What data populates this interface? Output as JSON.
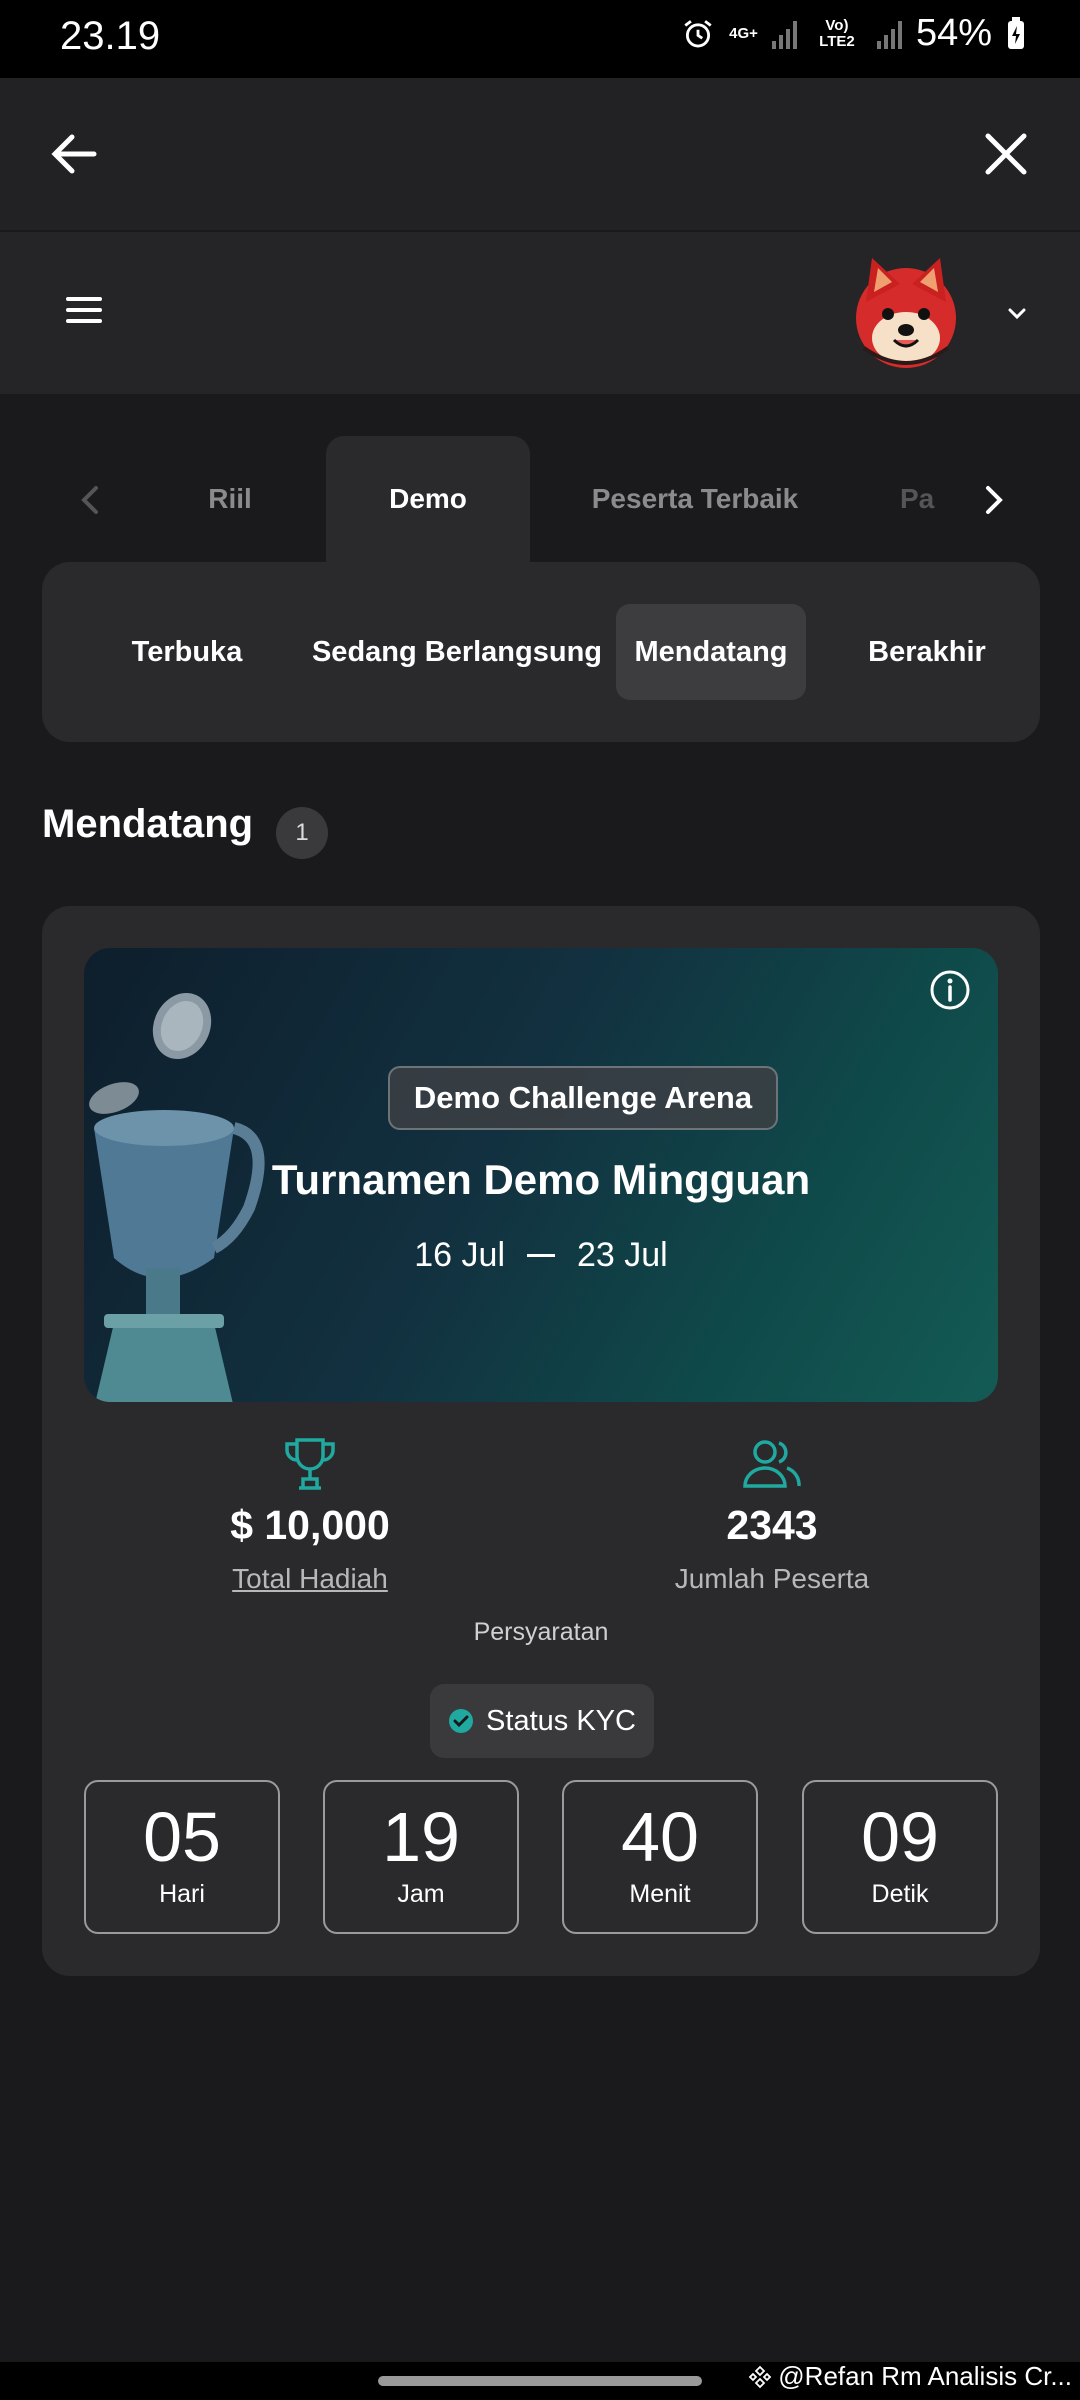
{
  "status_bar": {
    "time": "23.19",
    "network_top": "4G+",
    "network_bottom": "Vo) LTE2",
    "battery": "54%"
  },
  "tabs": {
    "items": [
      "Riil",
      "Demo",
      "Peserta Terbaik",
      "Pa"
    ],
    "active": "Demo"
  },
  "filters": {
    "items": [
      "Terbuka",
      "Sedang Berlangsung",
      "Mendatang",
      "Berakhir"
    ],
    "active": "Mendatang"
  },
  "section": {
    "title": "Mendatang",
    "count": "1"
  },
  "card": {
    "badge": "Demo Challenge Arena",
    "title": "Turnamen Demo Mingguan",
    "date_start": "16 Jul",
    "date_end": "23 Jul",
    "prize_value": "$ 10,000",
    "prize_label": "Total Hadiah",
    "participants_value": "2343",
    "participants_label": "Jumlah Peserta",
    "requirements_label": "Persyaratan",
    "kyc_label": "Status KYC",
    "countdown": [
      {
        "value": "05",
        "unit": "Hari"
      },
      {
        "value": "19",
        "unit": "Jam"
      },
      {
        "value": "40",
        "unit": "Menit"
      },
      {
        "value": "09",
        "unit": "Detik"
      }
    ]
  },
  "watermark": "@Refan Rm Analisis Cr...",
  "colors": {
    "accent_teal": "#1fa9a0",
    "background": "#1a1a1c",
    "surface": "#2a2a2c"
  },
  "icons": [
    "back-arrow-icon",
    "close-icon",
    "menu-icon",
    "shiba-avatar-icon",
    "chevron-down-icon",
    "chevron-left-icon",
    "chevron-right-icon",
    "info-icon",
    "trophy-icon",
    "users-icon",
    "check-circle-icon"
  ]
}
